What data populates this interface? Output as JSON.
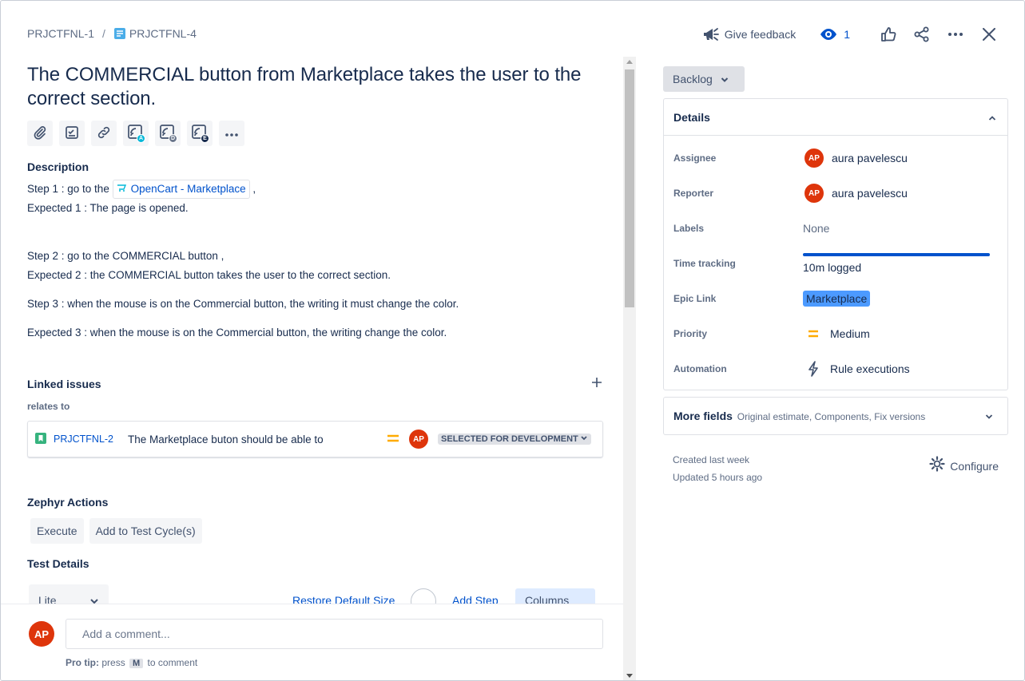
{
  "breadcrumb": {
    "parent": "PRJCTFNL-1",
    "separator": "/",
    "current": "PRJCTFNL-4"
  },
  "topbar": {
    "feedback_label": "Give feedback",
    "watch_count": "1"
  },
  "issue": {
    "title": "The COMMERCIAL button from Marketplace takes the user to the correct section."
  },
  "toolbar": {
    "badges": {
      "a": "A",
      "d": "D",
      "e": "E"
    },
    "colors": {
      "a": "#00b8d9",
      "d": "#6b778c",
      "e": "#172b4d"
    }
  },
  "description": {
    "heading": "Description",
    "step1_prefix": "Step 1 : go to the",
    "step1_link": "OpenCart - Marketplace",
    "step1_suffix": ",",
    "expected1": "Expected 1 : The page is opened.",
    "step2": "Step 2 : go to the COMMERCIAL button ,",
    "expected2": "Expected 2 : the COMMERCIAL button takes the user to the correct section.",
    "step3": "Step 3 : when the mouse is on the Commercial button, the writing it must change the color.",
    "expected3": "Expected 3 : when the mouse is on the Commercial button, the writing  change the color."
  },
  "linked": {
    "heading": "Linked issues",
    "relation": "relates to",
    "items": [
      {
        "key": "PRJCTFNL-2",
        "summary": "The Marketplace buton should be able to",
        "avatar": "AP",
        "status": "SELECTED FOR DEVELOPMENT"
      }
    ]
  },
  "zephyr": {
    "heading": "Zephyr Actions",
    "execute": "Execute",
    "add_cycle": "Add to Test Cycle(s)"
  },
  "test_details": {
    "heading": "Test Details",
    "view": "Lite",
    "restore": "Restore Default Size",
    "add_step": "Add Step",
    "columns": "Columns"
  },
  "comment": {
    "avatar": "AP",
    "placeholder": "Add a comment...",
    "tip_label": "Pro tip:",
    "tip_press": "press",
    "tip_key": "M",
    "tip_suffix": "to comment"
  },
  "status": {
    "label": "Backlog"
  },
  "details": {
    "heading": "Details",
    "assignee_label": "Assignee",
    "assignee": "aura pavelescu",
    "assignee_initials": "AP",
    "reporter_label": "Reporter",
    "reporter": "aura pavelescu",
    "reporter_initials": "AP",
    "labels_label": "Labels",
    "labels": "None",
    "time_label": "Time tracking",
    "time": "10m logged",
    "epic_label": "Epic Link",
    "epic": "Marketplace",
    "priority_label": "Priority",
    "priority": "Medium",
    "automation_label": "Automation",
    "automation": "Rule executions"
  },
  "more_fields": {
    "title": "More fields",
    "subtitle": "Original estimate, Components, Fix versions"
  },
  "meta": {
    "created": "Created last week",
    "updated": "Updated 5 hours ago",
    "configure": "Configure"
  },
  "colors": {
    "avatar": "#de350b",
    "link": "#0052cc",
    "priority_medium": "#ffab00",
    "epic": "#4c9aff",
    "story": "#36b37e"
  }
}
